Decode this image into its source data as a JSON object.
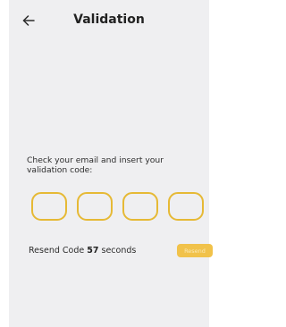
{
  "header": {
    "title": "Validation"
  },
  "instruction": {
    "text": "Check your email and insert your validation code:"
  },
  "code_inputs": [
    {
      "value": ""
    },
    {
      "value": ""
    },
    {
      "value": ""
    },
    {
      "value": ""
    }
  ],
  "resend": {
    "prefix": "Resend Code",
    "seconds": "57",
    "suffix": "seconds",
    "button_label": "Resend"
  },
  "colors": {
    "accent": "#e6b935",
    "button_bg": "#f1c24a",
    "screen_bg": "#efeff1"
  },
  "icons": {
    "back": "arrow-left-icon"
  }
}
